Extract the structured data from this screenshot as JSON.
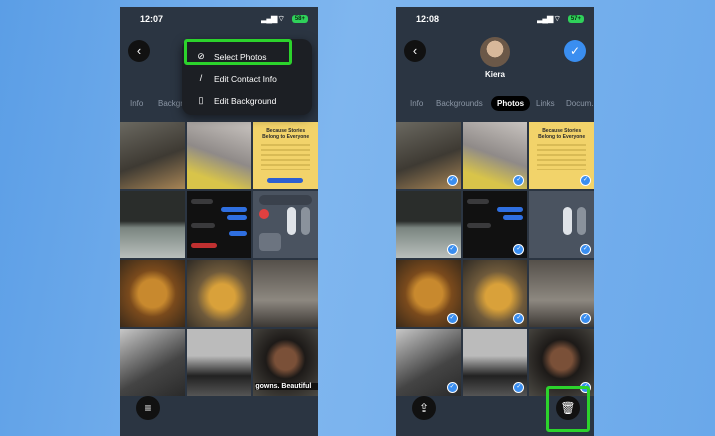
{
  "left_screen": {
    "status": {
      "time": "12:07",
      "battery": "58+"
    },
    "menu": {
      "items": [
        {
          "label": "Select Photos",
          "icon": "checkmark-circle-icon"
        },
        {
          "label": "Edit Contact Info",
          "icon": "pencil-icon"
        },
        {
          "label": "Edit Background",
          "icon": "phone-icon"
        }
      ]
    },
    "tabs": [
      "Info",
      "Backgr..."
    ],
    "caption": "gowns. Beautiful"
  },
  "right_screen": {
    "status": {
      "time": "12:08",
      "battery": "57+"
    },
    "contact_name": "Kiera",
    "tabs": [
      "Info",
      "Backgrounds",
      "Photos",
      "Links",
      "Docum..."
    ],
    "active_tab": "Photos"
  },
  "poster": {
    "title": "Because Stories Belong to Everyone"
  },
  "colors": {
    "highlight": "#2cd32c",
    "accent": "#3a8ef0",
    "background": "#6aa8ea"
  }
}
